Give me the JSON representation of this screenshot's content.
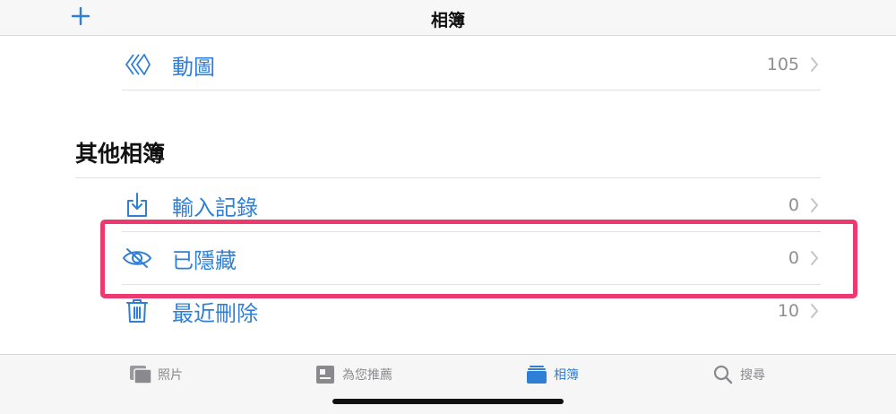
{
  "nav": {
    "title": "相簿",
    "add_icon": "plus-icon"
  },
  "rows_top": [
    {
      "label": "動圖",
      "count": "105",
      "icon": "animated-icon"
    }
  ],
  "section": {
    "title": "其他相簿"
  },
  "rows_other": [
    {
      "label": "輸入記錄",
      "count": "0",
      "icon": "import-icon"
    },
    {
      "label": "已隱藏",
      "count": "0",
      "icon": "eye-slash-icon",
      "highlighted": true
    },
    {
      "label": "最近刪除",
      "count": "10",
      "icon": "trash-icon"
    }
  ],
  "tabs": [
    {
      "label": "照片",
      "icon": "photos-icon",
      "active": false
    },
    {
      "label": "為您推薦",
      "icon": "for-you-icon",
      "active": false
    },
    {
      "label": "相簿",
      "icon": "albums-icon",
      "active": true
    },
    {
      "label": "搜尋",
      "icon": "search-icon",
      "active": false
    }
  ],
  "colors": {
    "accent": "#2f7fd6",
    "highlight_border": "#ec3a70",
    "secondary_text": "#8e8e93"
  }
}
